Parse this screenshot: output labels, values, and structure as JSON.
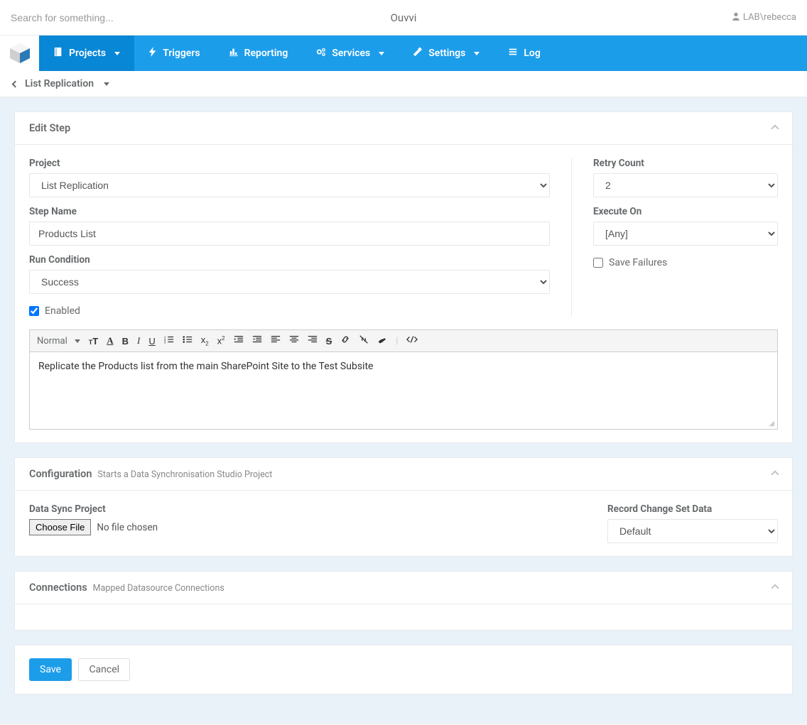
{
  "header": {
    "search_placeholder": "Search for something...",
    "app_title": "Ouvvi",
    "user_label": "LAB\\rebecca"
  },
  "nav": {
    "items": [
      {
        "label": "Projects",
        "icon": "book-icon",
        "dropdown": true,
        "active": true
      },
      {
        "label": "Triggers",
        "icon": "bolt-icon",
        "dropdown": false,
        "active": false
      },
      {
        "label": "Reporting",
        "icon": "chart-icon",
        "dropdown": false,
        "active": false
      },
      {
        "label": "Services",
        "icon": "cogs-icon",
        "dropdown": true,
        "active": false
      },
      {
        "label": "Settings",
        "icon": "wand-icon",
        "dropdown": true,
        "active": false
      },
      {
        "label": "Log",
        "icon": "list-icon",
        "dropdown": false,
        "active": false
      }
    ]
  },
  "breadcrumb": {
    "label": "List Replication"
  },
  "edit_step": {
    "panel_title": "Edit Step",
    "labels": {
      "project": "Project",
      "step_name": "Step Name",
      "run_condition": "Run Condition",
      "enabled": "Enabled",
      "retry_count": "Retry Count",
      "execute_on": "Execute On",
      "save_failures": "Save Failures"
    },
    "values": {
      "project": "List Replication",
      "step_name": "Products List",
      "run_condition": "Success",
      "enabled": true,
      "retry_count": "2",
      "execute_on": "[Any]",
      "save_failures": false
    },
    "editor": {
      "style_label": "Normal",
      "content": "Replicate the Products list from the main SharePoint Site to the Test Subsite"
    }
  },
  "configuration": {
    "panel_title": "Configuration",
    "panel_subtitle": "Starts a Data Synchronisation Studio Project",
    "labels": {
      "data_sync_project": "Data Sync Project",
      "record_change_set": "Record Change Set Data"
    },
    "values": {
      "choose_file_btn": "Choose File",
      "file_status": "No file chosen",
      "record_change_set": "Default"
    }
  },
  "connections": {
    "panel_title": "Connections",
    "panel_subtitle": "Mapped Datasource Connections"
  },
  "actions": {
    "save": "Save",
    "cancel": "Cancel"
  }
}
